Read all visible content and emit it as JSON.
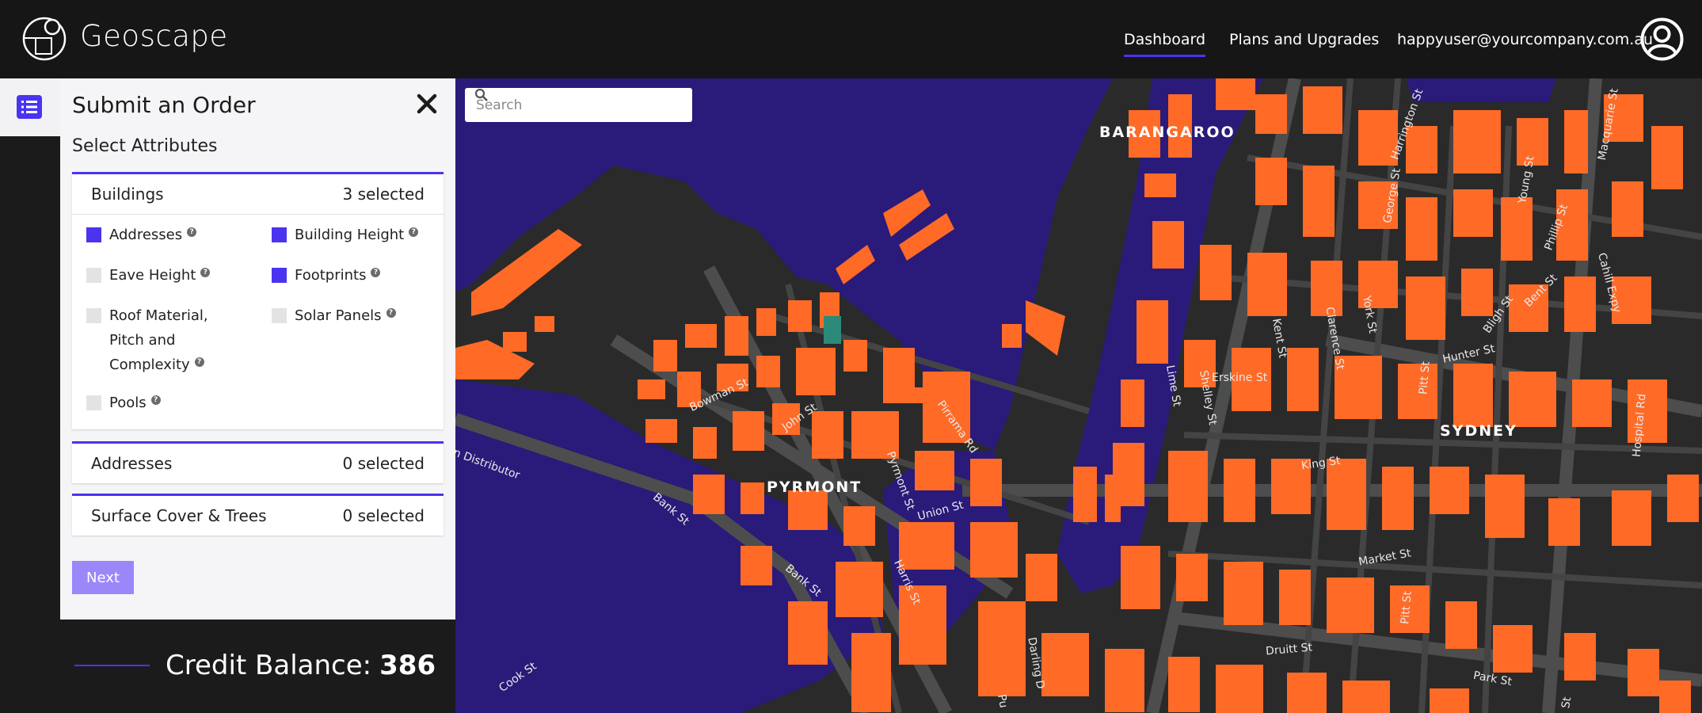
{
  "header": {
    "brand": "Geoscape",
    "nav": {
      "dashboard": "Dashboard",
      "plans": "Plans and Upgrades",
      "email": "happyuser@yourcompany.com.au"
    }
  },
  "panel": {
    "title": "Submit an Order",
    "subtitle": "Select Attributes",
    "sections": [
      {
        "name": "Buildings",
        "count": "3 selected",
        "options": [
          {
            "label": "Addresses",
            "checked": true
          },
          {
            "label": "Building Height",
            "checked": true
          },
          {
            "label": "Eave Height",
            "checked": false
          },
          {
            "label": "Footprints",
            "checked": true
          },
          {
            "label": "Roof Material,",
            "label2": "Pitch and",
            "label3": "Complexity",
            "checked": false
          },
          {
            "label": "Solar Panels",
            "checked": false
          },
          {
            "label": "Pools",
            "checked": false
          }
        ]
      },
      {
        "name": "Addresses",
        "count": "0 selected"
      },
      {
        "name": "Surface Cover & Trees",
        "count": "0 selected"
      }
    ],
    "next_label": "Next",
    "help_glyph": "?"
  },
  "credit": {
    "label": "Credit Balance:",
    "value": "386"
  },
  "map": {
    "search_placeholder": "Search",
    "areas": {
      "barangaroo": "BARANGAROO",
      "pyrmont": "PYRMONT",
      "sydney": "SYDNEY"
    },
    "streets": {
      "bowman": "Bowman St",
      "john": "John St",
      "pirrama": "Pirrama Rd",
      "pyrmont_st": "Pyrmont St",
      "union": "Union St",
      "harris": "Harris St",
      "bank1": "Bank St",
      "bank2": "Bank St",
      "distributor": "rn Distributor",
      "cook": "Cook St",
      "darling": "Darling D",
      "pu": "Pu",
      "erskine": "Erskine St",
      "kent": "Kent St",
      "clarence": "Clarence St",
      "york": "York St",
      "lime": "Lime St",
      "shelley": "Shelley St",
      "king": "King St",
      "market": "Market St",
      "druitt": "Druitt St",
      "park": "Park St",
      "pitt1": "Pitt St",
      "pitt2": "Pitt St",
      "hunter": "Hunter St",
      "bligh": "Bligh St",
      "bent": "Bent St",
      "phillip": "Phillip St",
      "young": "Young St",
      "george": "George St",
      "harrington": "Harrington St",
      "macquarie": "Macquarie St",
      "cahill": "Cahill Expy",
      "hospital": "Hospital Rd",
      "st": "St"
    }
  },
  "colors": {
    "accent": "#4a34f0",
    "water": "#2a1a7a",
    "building": "#ff6a26",
    "road": "#4a4a4a"
  }
}
